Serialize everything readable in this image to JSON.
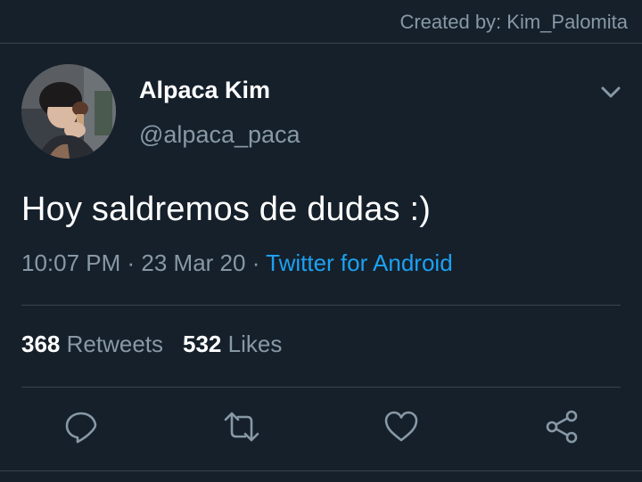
{
  "credit": "Created by: Kim_Palomita",
  "author": {
    "display_name": "Alpaca Kim",
    "handle": "@alpaca_paca"
  },
  "tweet": {
    "text": "Hoy saldremos de dudas :)"
  },
  "meta": {
    "time": "10:07 PM",
    "separator": " · ",
    "date": "23 Mar 20",
    "separator2": " · ",
    "source": "Twitter for Android"
  },
  "stats": {
    "retweets_count": "368",
    "retweets_label": "Retweets",
    "likes_count": "532",
    "likes_label": "Likes"
  },
  "icons": {
    "reply": "reply-icon",
    "retweet": "retweet-icon",
    "like": "heart-icon",
    "share": "share-icon",
    "more": "chevron-down-icon"
  },
  "colors": {
    "background": "#15202b",
    "divider": "#38444d",
    "muted": "#8899a6",
    "accent": "#1da1f2",
    "text": "#ffffff"
  }
}
